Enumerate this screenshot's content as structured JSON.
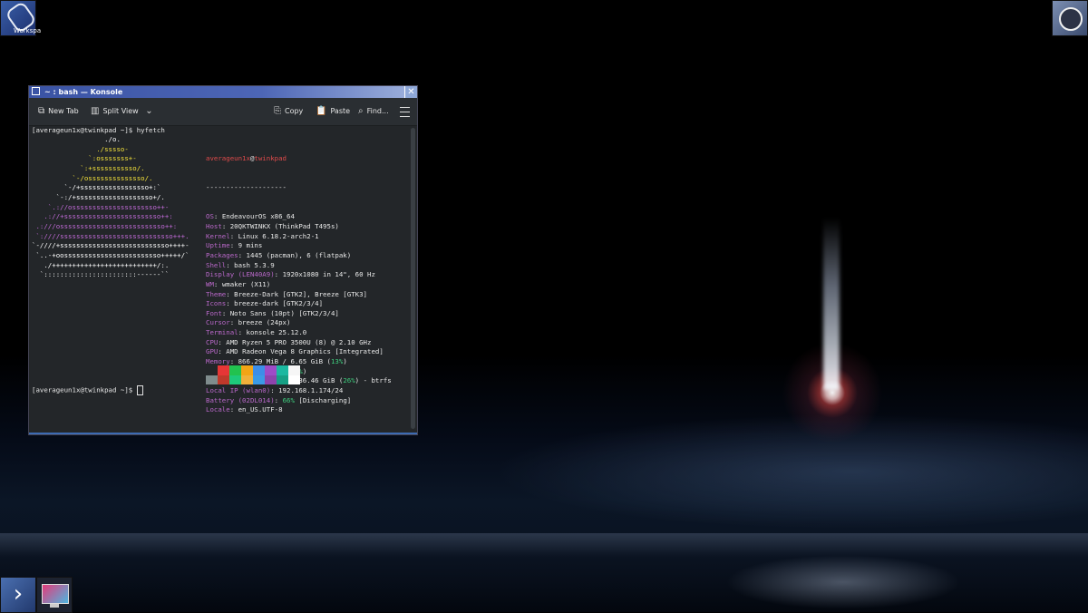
{
  "desktop": {
    "workspace_icon_label": "Workspa"
  },
  "window": {
    "title": "~ : bash — Konsole",
    "close_glyph": "✕"
  },
  "toolbar": {
    "new_tab": "New Tab",
    "split_view": "Split View",
    "copy": "Copy",
    "paste": "Paste",
    "find": "Find..."
  },
  "terminal": {
    "prompt_1": "[averageun1x@twinkpad ~]$ hyfetch",
    "prompt_2": "[averageun1x@twinkpad ~]$ ",
    "logo_lines": [
      "                  ./o.",
      "                ./sssso-",
      "              `:osssssss+-",
      "            `:+sssssssssso/.",
      "          `-/ossssssssssssso/.",
      "        `-/+sssssssssssssssso+:`",
      "      `-:/+sssssssssssssssssso+/.",
      "    `.://osssssssssssssssssssso++-",
      "   .://+ssssssssssssssssssssssso++:",
      " .:///ossssssssssssssssssssssssso++:",
      " `:////ssssssssssssssssssssssssssso+++.",
      "`-////+sssssssssssssssssssssssssso++++-",
      " `..-+oossssssssssssssssssssssso+++++/`",
      "   ./++++++++++++++++++++++++++/:.",
      "  `:::::::::::::::::::::::------``"
    ],
    "logo_colors": [
      "#ffffff",
      "#f4e23a",
      "#f4e23a",
      "#f4e23a",
      "#f4e23a",
      "#ffffff",
      "#ffffff",
      "#c26bd9",
      "#c26bd9",
      "#c26bd9",
      "#c26bd9",
      "#ffffff",
      "#ffffff",
      "#ffffff",
      "#ffffff"
    ],
    "user": "averageun1x",
    "at": "@",
    "host": "twinkpad",
    "separator": "--------------------",
    "info": [
      {
        "key": "OS",
        "value": "EndeavourOS x86_64"
      },
      {
        "key": "Host",
        "value": "20QKTWINKX (ThinkPad T495s)"
      },
      {
        "key": "Kernel",
        "value": "Linux 6.18.2-arch2-1"
      },
      {
        "key": "Uptime",
        "value": "9 mins"
      },
      {
        "key": "Packages",
        "value": "1445 (pacman), 6 (flatpak)"
      },
      {
        "key": "Shell",
        "value": "bash 5.3.9"
      },
      {
        "key": "Display (LEN40A9)",
        "value": "1920x1080 in 14\", 60 Hz"
      },
      {
        "key": "WM",
        "value": "wmaker (X11)"
      },
      {
        "key": "Theme",
        "value": "Breeze-Dark [GTK2], Breeze [GTK3]"
      },
      {
        "key": "Icons",
        "value": "breeze-dark [GTK2/3/4]"
      },
      {
        "key": "Font",
        "value": "Noto Sans (10pt) [GTK2/3/4]"
      },
      {
        "key": "Cursor",
        "value": "breeze (24px)"
      },
      {
        "key": "Terminal",
        "value": "konsole 25.12.0"
      },
      {
        "key": "CPU",
        "value": "AMD Ryzen 5 PRO 3500U (8) @ 2.10 GHz"
      },
      {
        "key": "GPU",
        "value": "AMD Radeon Vega 8 Graphics [Integrated]"
      },
      {
        "key": "Memory",
        "value": "866.29 MiB / 6.65 GiB (",
        "pct": "13%",
        "tail": ")"
      },
      {
        "key": "Swap",
        "value": "0 B / 3.32 GiB (",
        "pct": "0%",
        "tail": ")"
      },
      {
        "key": "Disk (/)",
        "value": "62.46 GiB / 236.46 GiB (",
        "pct": "26%",
        "tail": ") - btrfs"
      },
      {
        "key": "Local IP (wlan0)",
        "value": "192.168.1.174/24"
      },
      {
        "key": "Battery (02DL014)",
        "value": "",
        "pct": "66%",
        "tail": " [Discharging]"
      },
      {
        "key": "Locale",
        "value": "en_US.UTF-8"
      }
    ],
    "palette_top": [
      "#232629",
      "#e63636",
      "#22c24f",
      "#f2a516",
      "#3d8ee8",
      "#9e4cc7",
      "#1bb8a0",
      "#f6f6f6"
    ],
    "palette_bottom": [
      "#7f8c8d",
      "#c0392b",
      "#1ec97a",
      "#f0b03a",
      "#3b9ae6",
      "#8e44ad",
      "#16a085",
      "#ffffff"
    ]
  }
}
